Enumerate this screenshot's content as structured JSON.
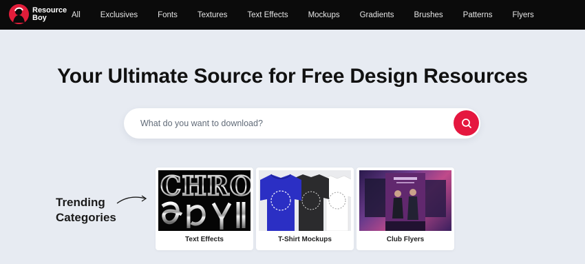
{
  "brand": {
    "name": "Resource\nBoy",
    "accent": "#e11d3a"
  },
  "nav": {
    "items": [
      "All",
      "Exclusives",
      "Fonts",
      "Textures",
      "Text Effects",
      "Mockups",
      "Gradients",
      "Brushes",
      "Patterns",
      "Flyers"
    ]
  },
  "hero": {
    "title": "Your Ultimate Source for Free Design Resources"
  },
  "search": {
    "placeholder": "What do you want to download?",
    "value": "",
    "button_icon": "search-icon",
    "button_color": "#e5173f"
  },
  "trending": {
    "label": "Trending Categories",
    "cards": [
      {
        "label": "Text Effects",
        "thumb_text": "CHRO"
      },
      {
        "label": "T-Shirt Mockups"
      },
      {
        "label": "Club Flyers"
      }
    ]
  }
}
